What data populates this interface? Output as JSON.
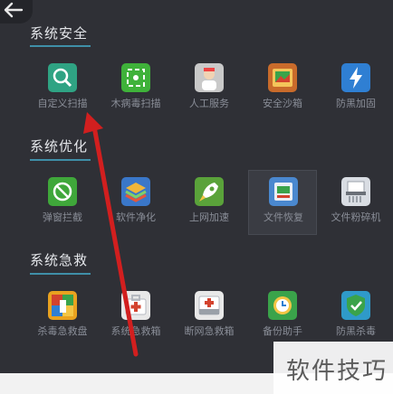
{
  "sections": [
    {
      "title": "系统安全",
      "tiles": [
        {
          "label": "自定义扫描",
          "icon": "magnifier-scan-icon",
          "color": "#2fa383"
        },
        {
          "label": "木病毒扫描",
          "icon": "virus-scan-icon",
          "color": "#3fb23a"
        },
        {
          "label": "人工服务",
          "icon": "support-agent-icon",
          "color": "#c9c9c9"
        },
        {
          "label": "安全沙箱",
          "icon": "sandbox-icon",
          "color": "#c96b2b"
        },
        {
          "label": "防黑加固",
          "icon": "lightning-shield-icon",
          "color": "#2f7fd3"
        }
      ]
    },
    {
      "title": "系统优化",
      "tiles": [
        {
          "label": "弹窗拦截",
          "icon": "popup-block-icon",
          "color": "#3fa73a"
        },
        {
          "label": "软件净化",
          "icon": "layers-clean-icon",
          "color": "#3a77c9"
        },
        {
          "label": "上网加速",
          "icon": "rocket-speed-icon",
          "color": "#5aa23a"
        },
        {
          "label": "文件恢复",
          "icon": "file-recovery-icon",
          "color": "#4a88cf"
        },
        {
          "label": "文件粉碎机",
          "icon": "file-shredder-icon",
          "color": "#d9dde3"
        }
      ]
    },
    {
      "title": "系统急救",
      "tiles": [
        {
          "label": "杀毒急救盘",
          "icon": "rescue-disk-icon",
          "color": "#e9a21f"
        },
        {
          "label": "系统急救箱",
          "icon": "system-first-aid-icon",
          "color": "#e8e8e8"
        },
        {
          "label": "断网急救箱",
          "icon": "network-first-aid-icon",
          "color": "#e8e8e8"
        },
        {
          "label": "备份助手",
          "icon": "backup-clock-icon",
          "color": "#3aa34a"
        },
        {
          "label": "防黑杀毒",
          "icon": "shield-check-icon",
          "color": "#2f9ac9"
        }
      ]
    }
  ],
  "watermark": "软件技巧",
  "colors": {
    "background": "#2f3036",
    "accent": "#3f8fa8",
    "annotation_arrow": "#d21f1f"
  }
}
